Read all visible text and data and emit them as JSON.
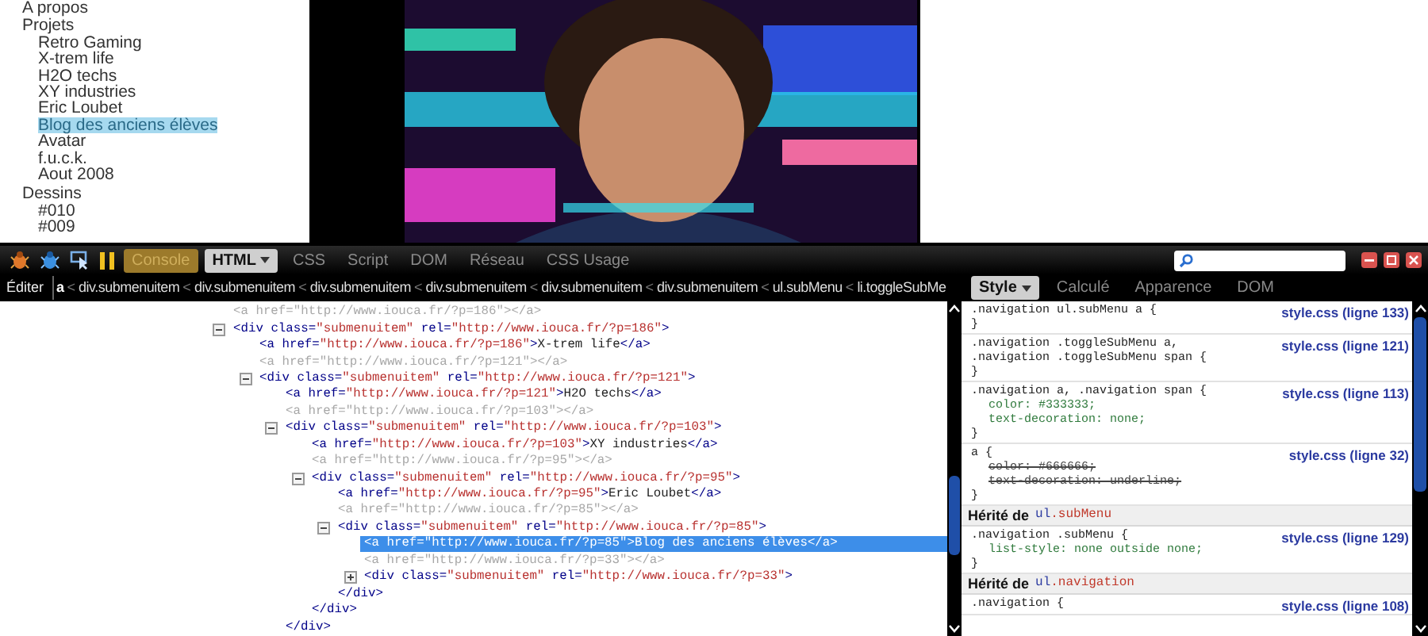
{
  "page": {
    "nav": [
      {
        "label": "A propos",
        "selected": false
      },
      {
        "label": "Projets",
        "selected": false,
        "children": [
          {
            "label": "Retro Gaming",
            "selected": false
          },
          {
            "label": "X-trem life",
            "selected": false
          },
          {
            "label": "H2O techs",
            "selected": false
          },
          {
            "label": "XY industries",
            "selected": false
          },
          {
            "label": "Eric Loubet",
            "selected": false
          },
          {
            "label": "Blog des anciens élèves",
            "selected": true
          },
          {
            "label": "Avatar",
            "selected": false
          },
          {
            "label": "f.u.c.k.",
            "selected": false
          },
          {
            "label": "Aout 2008",
            "selected": false
          }
        ]
      },
      {
        "label": "Dessins",
        "selected": false,
        "children": [
          {
            "label": "#010",
            "selected": false
          },
          {
            "label": "#009",
            "selected": false
          }
        ]
      }
    ]
  },
  "devtools": {
    "tabs": [
      {
        "label": "Console",
        "selected": false,
        "highlighted": true,
        "menu": false
      },
      {
        "label": "HTML",
        "selected": true,
        "highlighted": false,
        "menu": true
      },
      {
        "label": "CSS",
        "selected": false,
        "highlighted": false,
        "menu": false
      },
      {
        "label": "Script",
        "selected": false,
        "highlighted": false,
        "menu": false
      },
      {
        "label": "DOM",
        "selected": false,
        "highlighted": false,
        "menu": false
      },
      {
        "label": "Réseau",
        "selected": false,
        "highlighted": false,
        "menu": false
      },
      {
        "label": "CSS Usage",
        "selected": false,
        "highlighted": false,
        "menu": false
      }
    ],
    "breadcrumb": {
      "edit_button": "Éditer",
      "separator": "<",
      "items": [
        {
          "label": "a",
          "selected": true
        },
        {
          "label": "div.submenuitem",
          "selected": false
        },
        {
          "label": "div.submenuitem",
          "selected": false
        },
        {
          "label": "div.submenuitem",
          "selected": false
        },
        {
          "label": "div.submenuitem",
          "selected": false
        },
        {
          "label": "div.submenuitem",
          "selected": false
        },
        {
          "label": "div.submenuitem",
          "selected": false
        },
        {
          "label": "ul.subMenu",
          "selected": false
        },
        {
          "label": "li.toggleSubMe",
          "selected": false
        }
      ]
    },
    "html_tree": [
      {
        "kind": "ghost",
        "text": "<a href=\"http://www.iouca.fr/?p=186\"></a>",
        "selected": false
      },
      {
        "kind": "element",
        "text": "<div class=\"submenuitem\" rel=\"http://www.iouca.fr/?p=186\">",
        "selected": false,
        "expanded": true,
        "children": [
          {
            "kind": "link",
            "text": "<a href=\"http://www.iouca.fr/?p=186\">X-trem life</a>",
            "selected": false
          },
          {
            "kind": "ghost",
            "text": "<a href=\"http://www.iouca.fr/?p=121\"></a>",
            "selected": false
          },
          {
            "kind": "element",
            "text": "<div class=\"submenuitem\" rel=\"http://www.iouca.fr/?p=121\">",
            "selected": false,
            "expanded": true,
            "children": [
              {
                "kind": "link",
                "text": "<a href=\"http://www.iouca.fr/?p=121\">H2O techs</a>",
                "selected": false
              },
              {
                "kind": "ghost",
                "text": "<a href=\"http://www.iouca.fr/?p=103\"></a>",
                "selected": false
              },
              {
                "kind": "element",
                "text": "<div class=\"submenuitem\" rel=\"http://www.iouca.fr/?p=103\">",
                "selected": false,
                "expanded": true,
                "close": "</div>",
                "children": [
                  {
                    "kind": "link",
                    "text": "<a href=\"http://www.iouca.fr/?p=103\">XY industries</a>",
                    "selected": false
                  },
                  {
                    "kind": "ghost",
                    "text": "<a href=\"http://www.iouca.fr/?p=95\"></a>",
                    "selected": false
                  },
                  {
                    "kind": "element",
                    "text": "<div class=\"submenuitem\" rel=\"http://www.iouca.fr/?p=95\">",
                    "selected": false,
                    "expanded": true,
                    "close": "</div>",
                    "children": [
                      {
                        "kind": "link",
                        "text": "<a href=\"http://www.iouca.fr/?p=95\">Eric Loubet</a>",
                        "selected": false
                      },
                      {
                        "kind": "ghost",
                        "text": "<a href=\"http://www.iouca.fr/?p=85\"></a>",
                        "selected": false
                      },
                      {
                        "kind": "element",
                        "text": "<div class=\"submenuitem\" rel=\"http://www.iouca.fr/?p=85\">",
                        "selected": false,
                        "expanded": true,
                        "close": "</div>",
                        "children": [
                          {
                            "kind": "link",
                            "text": "<a href=\"http://www.iouca.fr/?p=85\">Blog des anciens élèves</a>",
                            "selected": true
                          },
                          {
                            "kind": "ghost",
                            "text": "<a href=\"http://www.iouca.fr/?p=33\"></a>",
                            "selected": false
                          },
                          {
                            "kind": "element",
                            "text": "<div class=\"submenuitem\" rel=\"http://www.iouca.fr/?p=33\">",
                            "selected": false,
                            "expanded": false
                          }
                        ]
                      }
                    ]
                  }
                ]
              }
            ]
          }
        ]
      }
    ],
    "side_tabs": [
      {
        "label": "Style",
        "selected": true,
        "menu": true
      },
      {
        "label": "Calculé",
        "selected": false,
        "menu": false
      },
      {
        "label": "Apparence",
        "selected": false,
        "menu": false
      },
      {
        "label": "DOM",
        "selected": false,
        "menu": false
      }
    ],
    "style_rules": [
      {
        "kind": "rule",
        "selector": [
          ".navigation ul.subMenu a {"
        ],
        "source": "style.css (ligne 133)",
        "close": "}"
      },
      {
        "kind": "rule",
        "selector": [
          ".navigation .toggleSubMenu a,",
          ".navigation .toggleSubMenu span {"
        ],
        "source": "style.css (ligne 121)",
        "close": "}"
      },
      {
        "kind": "rule",
        "selector": [
          ".navigation a, .navigation span {"
        ],
        "source": "style.css (ligne 113)",
        "props": [
          {
            "text": "color: #333333;",
            "overridden": false
          },
          {
            "text": "text-decoration: none;",
            "overridden": false
          }
        ],
        "close": "}"
      },
      {
        "kind": "rule",
        "selector": [
          "a {"
        ],
        "source": "style.css (ligne 32)",
        "props": [
          {
            "text": "color: #666666;",
            "overridden": true
          },
          {
            "text": "text-decoration: underline;",
            "overridden": true
          }
        ],
        "close": "}"
      },
      {
        "kind": "inherited",
        "label": "Hérité de",
        "element": "ul.subMenu"
      },
      {
        "kind": "rule",
        "selector": [
          ".navigation .subMenu {"
        ],
        "source": "style.css (ligne 129)",
        "props": [
          {
            "text": "list-style: none outside none;",
            "overridden": false
          }
        ],
        "close": "}"
      },
      {
        "kind": "inherited",
        "label": "Hérité de",
        "element": "ul.navigation"
      },
      {
        "kind": "rule",
        "selector": [
          ".navigation {"
        ],
        "source": "style.css (ligne 108)"
      }
    ]
  }
}
